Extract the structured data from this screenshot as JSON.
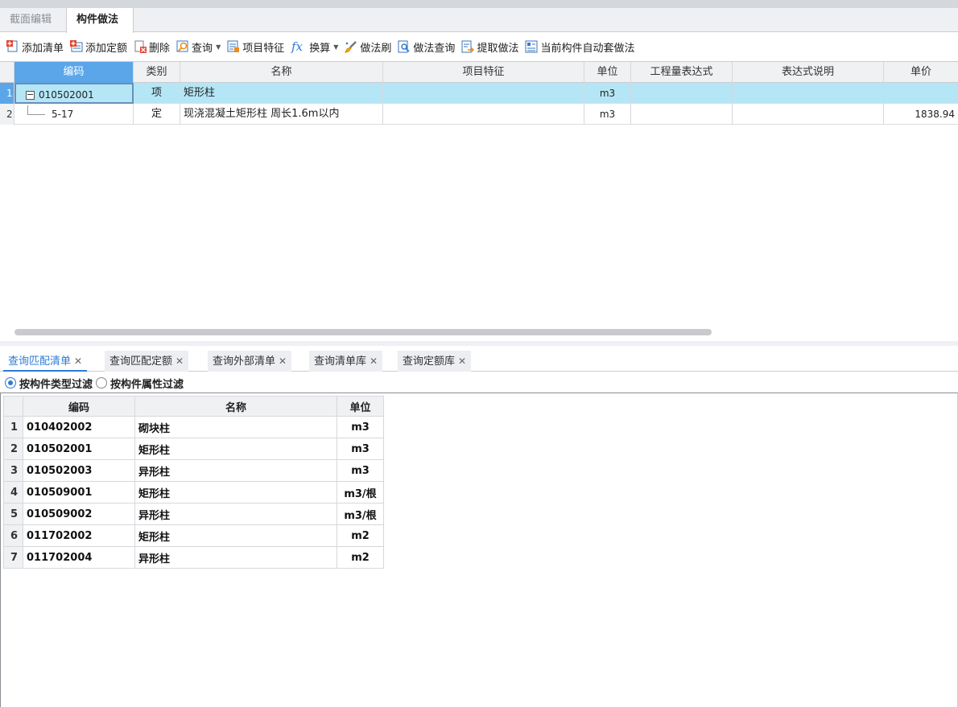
{
  "top_tabs": [
    "截面编辑",
    "构件做法"
  ],
  "toolbar": {
    "add_list": "添加清单",
    "add_quota": "添加定额",
    "delete": "删除",
    "query": "查询",
    "item_feature": "项目特征",
    "convert": "换算",
    "method_brush": "做法刷",
    "method_query": "做法查询",
    "extract_method": "提取做法",
    "auto_apply": "当前构件自动套做法"
  },
  "upper_grid": {
    "columns": [
      "编码",
      "类别",
      "名称",
      "项目特征",
      "单位",
      "工程量表达式",
      "表达式说明",
      "单价"
    ],
    "rows": [
      {
        "num": "1",
        "code": "010502001",
        "type": "项",
        "name": "矩形柱",
        "feature": "",
        "unit": "m3",
        "expr": "",
        "expr_note": "",
        "price": ""
      },
      {
        "num": "2",
        "code": "5-17",
        "type": "定",
        "name": "现浇混凝土矩形柱 周长1.6m以内",
        "feature": "",
        "unit": "m3",
        "expr": "",
        "expr_note": "",
        "price": "1838.94"
      }
    ]
  },
  "bottom_tabs": [
    "查询匹配清单",
    "查询匹配定额",
    "查询外部清单",
    "查询清单库",
    "查询定额库"
  ],
  "filters": [
    "按构件类型过滤",
    "按构件属性过滤"
  ],
  "lower_grid": {
    "columns": [
      "编码",
      "名称",
      "单位"
    ],
    "rows": [
      {
        "num": "1",
        "code": "010402002",
        "name": "砌块柱",
        "unit": "m3"
      },
      {
        "num": "2",
        "code": "010502001",
        "name": "矩形柱",
        "unit": "m3"
      },
      {
        "num": "3",
        "code": "010502003",
        "name": "异形柱",
        "unit": "m3"
      },
      {
        "num": "4",
        "code": "010509001",
        "name": "矩形柱",
        "unit": "m3/根"
      },
      {
        "num": "5",
        "code": "010509002",
        "name": "异形柱",
        "unit": "m3/根"
      },
      {
        "num": "6",
        "code": "011702002",
        "name": "矩形柱",
        "unit": "m2"
      },
      {
        "num": "7",
        "code": "011702004",
        "name": "异形柱",
        "unit": "m2"
      }
    ]
  }
}
